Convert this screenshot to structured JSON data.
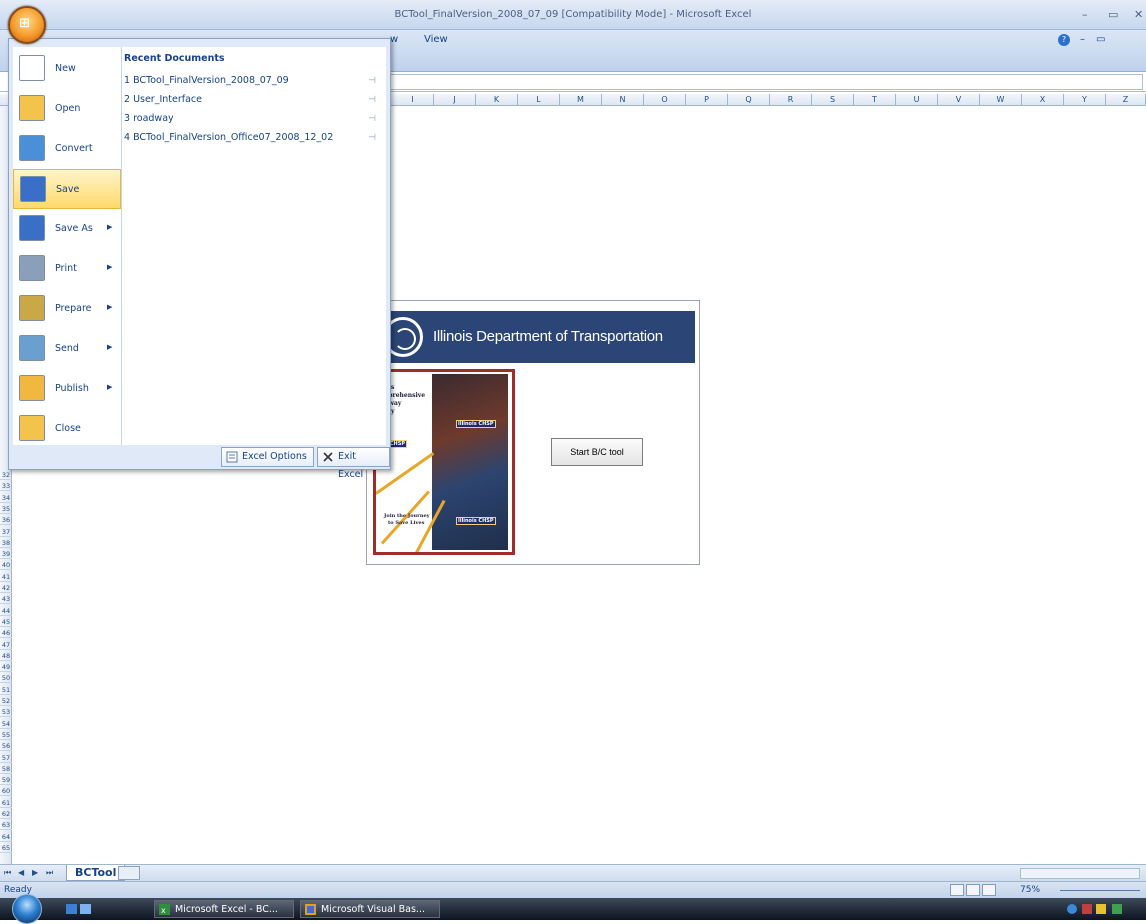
{
  "window": {
    "title": "BCTool_FinalVersion_2008_07_09  [Compatibility Mode] - Microsoft Excel",
    "min": "–",
    "restore": "▭",
    "close": "✕"
  },
  "ribbon": {
    "tabs": [
      "w",
      "View"
    ],
    "help_icon": "?"
  },
  "columns": [
    "I",
    "J",
    "K",
    "L",
    "M",
    "N",
    "O",
    "P",
    "Q",
    "R",
    "S",
    "T",
    "U",
    "V",
    "W",
    "X",
    "Y",
    "Z"
  ],
  "rows": [
    "32",
    "33",
    "34",
    "35",
    "36",
    "37",
    "38",
    "39",
    "40",
    "41",
    "42",
    "43",
    "44",
    "45",
    "46",
    "47",
    "48",
    "49",
    "50",
    "51",
    "52",
    "53",
    "54",
    "55",
    "56",
    "57",
    "58",
    "59",
    "60",
    "61",
    "62",
    "63",
    "64",
    "65"
  ],
  "office_menu": {
    "items": [
      {
        "label": "New",
        "icon": "new-document-icon",
        "arrow": false
      },
      {
        "label": "Open",
        "icon": "open-folder-icon",
        "arrow": false
      },
      {
        "label": "Convert",
        "icon": "convert-icon",
        "arrow": false
      },
      {
        "label": "Save",
        "icon": "save-floppy-icon",
        "arrow": false,
        "highlighted": true
      },
      {
        "label": "Save As",
        "icon": "save-as-icon",
        "arrow": true
      },
      {
        "label": "Print",
        "icon": "printer-icon",
        "arrow": true
      },
      {
        "label": "Prepare",
        "icon": "prepare-icon",
        "arrow": true
      },
      {
        "label": "Send",
        "icon": "send-icon",
        "arrow": true
      },
      {
        "label": "Publish",
        "icon": "publish-icon",
        "arrow": true
      },
      {
        "label": "Close",
        "icon": "close-folder-icon",
        "arrow": false
      }
    ],
    "recent_header": "Recent Documents",
    "recent": [
      "1  BCTool_FinalVersion_2008_07_09",
      "2  User_Interface",
      "3  roadway",
      "4  BCTool_FinalVersion_Office07_2008_12_02"
    ],
    "pin_glyph": "⊣",
    "options_label": "Excel Options",
    "exit_label": "Exit Excel"
  },
  "splash": {
    "banner_title": "Illinois Department of Transportation",
    "poster_lines": [
      "inois",
      "omprehensive",
      "ighway",
      "afety",
      "lan"
    ],
    "poster_badges": [
      "Illinois CHSP",
      "ois CHSP",
      "Illinois CHSP"
    ],
    "poster_tagline": [
      "Join the Journey",
      "to Save Lives"
    ],
    "start_button": "Start B/C tool"
  },
  "sheet": {
    "tab_name": "BCTool",
    "nav": [
      "⏮",
      "◀",
      "▶",
      "⏭"
    ]
  },
  "status": {
    "text": "Ready",
    "zoom": "75%"
  },
  "taskbar": {
    "buttons": [
      "Microsoft Excel - BC...",
      "Microsoft Visual Bas..."
    ]
  }
}
